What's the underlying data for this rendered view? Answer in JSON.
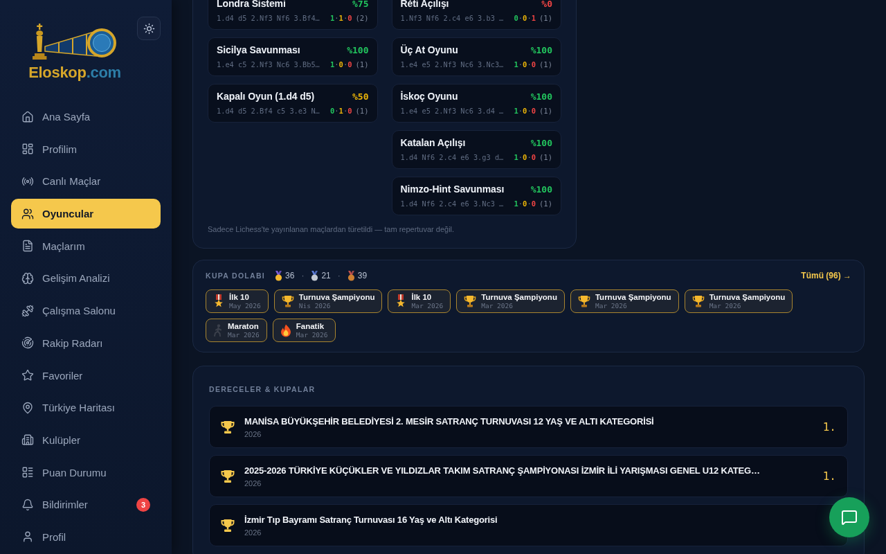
{
  "sidebar": {
    "logo": {
      "name": "Eloskop",
      "domain": ".com"
    },
    "nav": [
      {
        "label": "Ana Sayfa",
        "selected": false
      },
      {
        "label": "Profilim",
        "selected": false
      },
      {
        "label": "Canlı Maçlar",
        "selected": false
      },
      {
        "label": "Oyuncular",
        "selected": true
      },
      {
        "label": "Maçlarım",
        "selected": false
      },
      {
        "label": "Gelişim Analizi",
        "selected": false
      },
      {
        "label": "Çalışma Salonu",
        "selected": false
      },
      {
        "label": "Rakip Radarı",
        "selected": false
      },
      {
        "label": "Favoriler",
        "selected": false
      },
      {
        "label": "Türkiye Haritası",
        "selected": false
      },
      {
        "label": "Kulüpler",
        "selected": false
      },
      {
        "label": "Puan Durumu",
        "selected": false
      },
      {
        "label": "Bildirimler",
        "selected": false,
        "badge": "3"
      },
      {
        "label": "Profil",
        "selected": false
      }
    ]
  },
  "repertoire": {
    "columns": [
      {
        "cards": [
          {
            "name": "Londra Sistemi",
            "rate": "%75",
            "color": "#22c55e",
            "moves": "1.d4 d5 2.Nf3 Nf6 3.Bf4…",
            "record": [
              {
                "kind": "win",
                "text": "1"
              },
              {
                "kind": "sep",
                "text": "·"
              },
              {
                "kind": "draw",
                "text": "1"
              },
              {
                "kind": "sep",
                "text": "·"
              },
              {
                "kind": "loss",
                "text": "0"
              }
            ],
            "games": "(2)"
          },
          {
            "name": "Sicilya Savunması",
            "rate": "%100",
            "color": "#22c55e",
            "moves": "1.e4 c5 2.Nf3 Nc6 3.Bb5…",
            "record": [
              {
                "kind": "win",
                "text": "1"
              },
              {
                "kind": "sep",
                "text": "·"
              },
              {
                "kind": "draw",
                "text": "0"
              },
              {
                "kind": "sep",
                "text": "·"
              },
              {
                "kind": "loss",
                "text": "0"
              }
            ],
            "games": "(1)"
          },
          {
            "name": "Kapalı Oyun (1.d4 d5)",
            "rate": "%50",
            "color": "#eab308",
            "moves": "1.d4 d5 2.Bf4 c5 3.e3 N…",
            "record": [
              {
                "kind": "win",
                "text": "0"
              },
              {
                "kind": "sep",
                "text": "·"
              },
              {
                "kind": "draw",
                "text": "1"
              },
              {
                "kind": "sep",
                "text": "·"
              },
              {
                "kind": "loss",
                "text": "0"
              }
            ],
            "games": "(1)"
          }
        ]
      },
      {
        "cards": [
          {
            "name": "Réti Açılışı",
            "rate": "%0",
            "color": "#ef4444",
            "moves": "1.Nf3 Nf6 2.c4 e6 3.b3 …",
            "record": [
              {
                "kind": "win",
                "text": "0"
              },
              {
                "kind": "sep",
                "text": "·"
              },
              {
                "kind": "draw",
                "text": "0"
              },
              {
                "kind": "sep",
                "text": "·"
              },
              {
                "kind": "loss",
                "text": "1"
              }
            ],
            "games": "(1)"
          },
          {
            "name": "Üç At Oyunu",
            "rate": "%100",
            "color": "#22c55e",
            "moves": "1.e4 e5 2.Nf3 Nc6 3.Nc3…",
            "record": [
              {
                "kind": "win",
                "text": "1"
              },
              {
                "kind": "sep",
                "text": "·"
              },
              {
                "kind": "draw",
                "text": "0"
              },
              {
                "kind": "sep",
                "text": "·"
              },
              {
                "kind": "loss",
                "text": "0"
              }
            ],
            "games": "(1)"
          },
          {
            "name": "İskoç Oyunu",
            "rate": "%100",
            "color": "#22c55e",
            "moves": "1.e4 e5 2.Nf3 Nc6 3.d4 …",
            "record": [
              {
                "kind": "win",
                "text": "1"
              },
              {
                "kind": "sep",
                "text": "·"
              },
              {
                "kind": "draw",
                "text": "0"
              },
              {
                "kind": "sep",
                "text": "·"
              },
              {
                "kind": "loss",
                "text": "0"
              }
            ],
            "games": "(1)"
          },
          {
            "name": "Katalan Açılışı",
            "rate": "%100",
            "color": "#22c55e",
            "moves": "1.d4 Nf6 2.c4 e6 3.g3 d…",
            "record": [
              {
                "kind": "win",
                "text": "1"
              },
              {
                "kind": "sep",
                "text": "·"
              },
              {
                "kind": "draw",
                "text": "0"
              },
              {
                "kind": "sep",
                "text": "·"
              },
              {
                "kind": "loss",
                "text": "0"
              }
            ],
            "games": "(1)"
          },
          {
            "name": "Nimzo-Hint Savunması",
            "rate": "%100",
            "color": "#22c55e",
            "moves": "1.d4 Nf6 2.c4 e6 3.Nc3 …",
            "record": [
              {
                "kind": "win",
                "text": "1"
              },
              {
                "kind": "sep",
                "text": "·"
              },
              {
                "kind": "draw",
                "text": "0"
              },
              {
                "kind": "sep",
                "text": "·"
              },
              {
                "kind": "loss",
                "text": "0"
              }
            ],
            "games": "(1)"
          }
        ]
      }
    ],
    "footnote": "Sadece Lichess'te yayınlanan maçlardan türetildi — tam repertuvar değil."
  },
  "trophy_cabinet": {
    "title": "KUPA DOLABI",
    "medals": [
      {
        "kind": "gold",
        "count": "36"
      },
      {
        "kind": "silver",
        "separator": "·",
        "count": "21"
      },
      {
        "kind": "bronze",
        "separator": "·",
        "count": "39"
      }
    ],
    "link": "Tümü (96) →",
    "badges": [
      {
        "kind": "medal",
        "name": "İlk 10",
        "date": "May 2026"
      },
      {
        "kind": "trophy",
        "name": "Turnuva Şampiyonu",
        "date": "Nis 2026"
      },
      {
        "kind": "medal",
        "name": "İlk 10",
        "date": "Mar 2026"
      },
      {
        "kind": "trophy",
        "name": "Turnuva Şampiyonu",
        "date": "Mar 2026"
      },
      {
        "kind": "trophy",
        "name": "Turnuva Şampiyonu",
        "date": "Mar 2026"
      },
      {
        "kind": "trophy",
        "name": "Turnuva Şampiyonu",
        "date": "Mar 2026"
      },
      {
        "kind": "runner",
        "name": "Maraton",
        "date": "Mar 2026"
      },
      {
        "kind": "fire",
        "name": "Fanatik",
        "date": "Mar 2026"
      }
    ]
  },
  "rankings": {
    "title": "DERECELER & KUPALAR",
    "items": [
      {
        "name": "MANİSA BÜYÜKŞEHİR BELEDİYESİ 2. MESİR SATRANÇ TURNUVASI 12 YAŞ VE ALTI KATEGORİSİ",
        "year": "2026",
        "rank": "1."
      },
      {
        "name": "2025-2026 TÜRKİYE KÜÇÜKLER VE YILDIZLAR TAKIM SATRANÇ ŞAMPİYONASI İZMİR İLİ YARIŞMASI GENEL U12 KATEG…",
        "year": "2026",
        "rank": "1."
      },
      {
        "name": "İzmir Tıp Bayramı Satranç Turnuvası 16 Yaş ve Altı Kategorisi",
        "year": "2026"
      }
    ]
  }
}
